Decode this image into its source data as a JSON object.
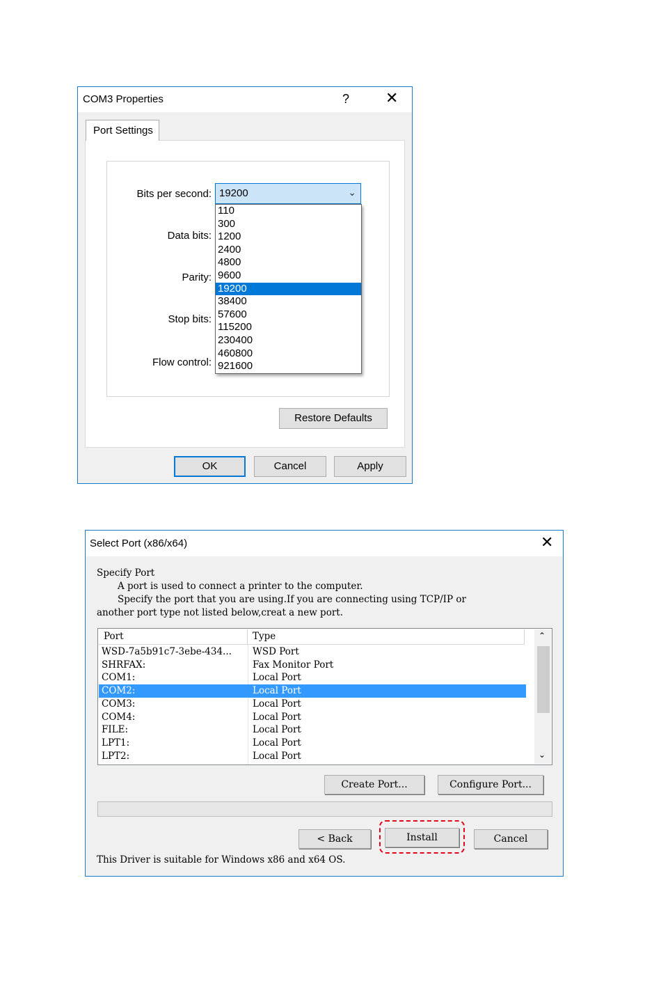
{
  "com3_dialog": {
    "title": "COM3 Properties",
    "help": "?",
    "close": "✕",
    "tab": "Port Settings",
    "labels": {
      "bits_per_second": "Bits per second:",
      "data_bits": "Data bits:",
      "parity": "Parity:",
      "stop_bits": "Stop bits:",
      "flow_control": "Flow control:"
    },
    "selected_baud": "19200",
    "baud_options": [
      "110",
      "300",
      "1200",
      "2400",
      "4800",
      "9600",
      "19200",
      "38400",
      "57600",
      "115200",
      "230400",
      "460800",
      "921600"
    ],
    "restore_defaults": "Restore Defaults",
    "ok": "OK",
    "cancel": "Cancel",
    "apply": "Apply",
    "accent_color": "#0078d7"
  },
  "select_port_dialog": {
    "title": "Select Port (x86/x64)",
    "close": "✕",
    "heading": "Specify Port",
    "desc1": "A port is used to connect a printer to the computer.",
    "desc2": "Specify the port that you are using.If you are connecting using TCP/IP or",
    "desc3": "another port type not listed below,creat a new port.",
    "columns": [
      "Port",
      "Type"
    ],
    "rows": [
      {
        "port": "WSD-7a5b91c7-3ebe-434...",
        "type": "WSD Port"
      },
      {
        "port": "SHRFAX:",
        "type": "Fax Monitor Port"
      },
      {
        "port": "COM1:",
        "type": "Local Port"
      },
      {
        "port": "COM2:",
        "type": "Local Port"
      },
      {
        "port": "COM3:",
        "type": "Local Port"
      },
      {
        "port": "COM4:",
        "type": "Local Port"
      },
      {
        "port": "FILE:",
        "type": "Local Port"
      },
      {
        "port": "LPT1:",
        "type": "Local Port"
      },
      {
        "port": "LPT2:",
        "type": "Local Port"
      }
    ],
    "selected_row": "COM2:",
    "create_port": "Create Port...",
    "configure_port": "Configure Port...",
    "back": "< Back",
    "install": "Install",
    "cancel": "Cancel",
    "footer": "This Driver is suitable for Windows x86 and x64 OS.",
    "highlight_color": "#e3001b"
  }
}
